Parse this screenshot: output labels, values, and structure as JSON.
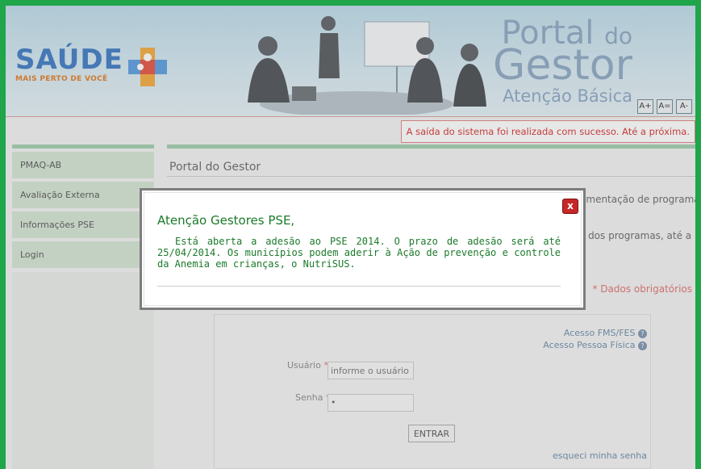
{
  "header": {
    "logo_text": "SAÚDE",
    "logo_sub": "MAIS PERTO DE VOCÊ",
    "portal_line1_a": "Portal",
    "portal_line1_b": "do",
    "portal_line2": "Gestor",
    "portal_line3": "Atenção Básica",
    "font_buttons": [
      "A+",
      "A=",
      "A-"
    ]
  },
  "notice": "A saída do sistema foi realizada com sucesso. Até a próxima.",
  "sidebar": {
    "items": [
      {
        "label": "PMAQ-AB"
      },
      {
        "label": "Avaliação Externa"
      },
      {
        "label": "Informações PSE"
      },
      {
        "label": "Login"
      }
    ]
  },
  "content": {
    "title": "Portal do Gestor",
    "text_right_1": "ementação de programas",
    "text_right_2": "s dos programas, até a",
    "required_note": "* Dados obrigatórios"
  },
  "login": {
    "link_fms": "Acesso FMS/FES",
    "link_pf": "Acesso Pessoa Física",
    "user_label": "Usuário",
    "user_placeholder": "informe o usuário",
    "password_label": "Senha",
    "password_value": "•",
    "enter_label": "ENTRAR",
    "forgot_label": "esqueci minha senha",
    "required_mark": "*"
  },
  "modal": {
    "title": "Atenção Gestores PSE,",
    "body": "Está aberta a adesão ao PSE 2014. O prazo de adesão será até 25/04/2014. Os municípios podem aderir à Ação de prevenção e controle da Anemia em crianças, o NutriSUS.",
    "close_icon": "x"
  },
  "colors": {
    "frame_green": "#1fa54a",
    "accent_green": "#1b7a2a",
    "notice_red": "#d63030",
    "logo_blue": "#3a78c2"
  }
}
